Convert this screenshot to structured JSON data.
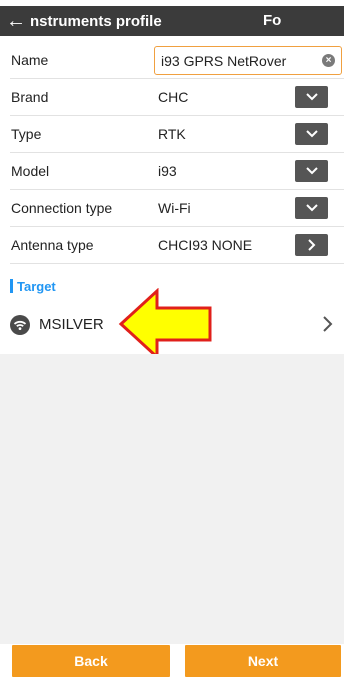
{
  "header": {
    "title": "nstruments profile",
    "tab_label": "Fo"
  },
  "form": {
    "name": {
      "label": "Name",
      "value": "i93 GPRS NetRover"
    },
    "brand": {
      "label": "Brand",
      "value": "CHC"
    },
    "type": {
      "label": "Type",
      "value": "RTK"
    },
    "model": {
      "label": "Model",
      "value": "i93"
    },
    "connection_type": {
      "label": "Connection type",
      "value": "Wi-Fi"
    },
    "antenna_type": {
      "label": "Antenna type",
      "value": "CHCI93 NONE"
    }
  },
  "section": {
    "label": "Target"
  },
  "target": {
    "label": "MSILVER"
  },
  "buttons": {
    "back": "Back",
    "next": "Next"
  },
  "colors": {
    "header_bg": "#3b3b3b",
    "accent_orange": "#f39a1e",
    "section_blue": "#2196f3",
    "annotation_yellow": "#ffff00",
    "annotation_red": "#e0201b"
  }
}
